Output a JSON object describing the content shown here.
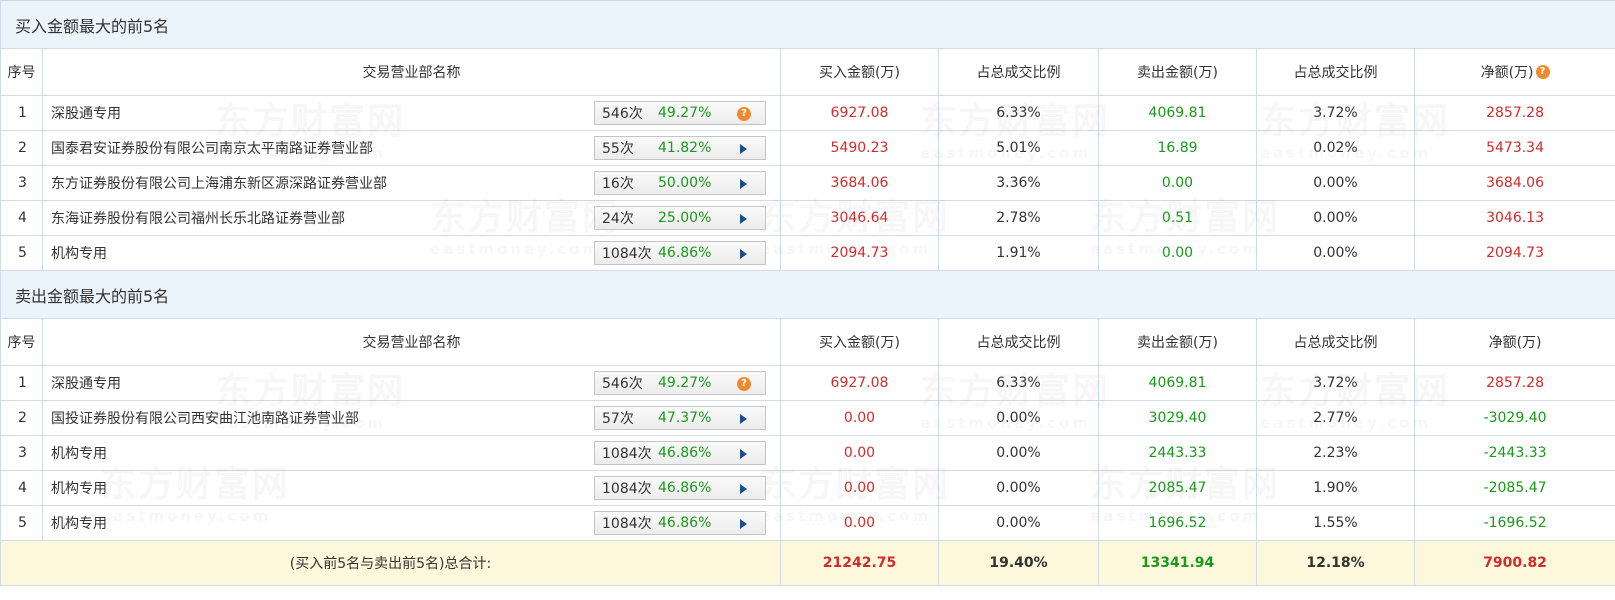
{
  "watermark": {
    "cn": "东方财富网",
    "en": "eastmoney.com"
  },
  "columns": [
    "序号",
    "交易营业部名称",
    "买入金额(万)",
    "占总成交比例",
    "卖出金额(万)",
    "占总成交比例",
    "净额(万)"
  ],
  "buy_section": {
    "title": "买入金额最大的前5名",
    "rows": [
      {
        "idx": "1",
        "name": "深股通专用",
        "count": "546次",
        "pct": "49.27%",
        "icon": "question-icon",
        "buy": "6927.08",
        "buy_ratio": "6.33%",
        "sell": "4069.81",
        "sell_ratio": "3.72%",
        "net": "2857.28"
      },
      {
        "idx": "2",
        "name": "国泰君安证券股份有限公司南京太平南路证券营业部",
        "count": "55次",
        "pct": "41.82%",
        "icon": "play-arrow-icon",
        "buy": "5490.23",
        "buy_ratio": "5.01%",
        "sell": "16.89",
        "sell_ratio": "0.02%",
        "net": "5473.34"
      },
      {
        "idx": "3",
        "name": "东方证券股份有限公司上海浦东新区源深路证券营业部",
        "count": "16次",
        "pct": "50.00%",
        "icon": "play-arrow-icon",
        "buy": "3684.06",
        "buy_ratio": "3.36%",
        "sell": "0.00",
        "sell_ratio": "0.00%",
        "net": "3684.06"
      },
      {
        "idx": "4",
        "name": "东海证券股份有限公司福州长乐北路证券营业部",
        "count": "24次",
        "pct": "25.00%",
        "icon": "play-arrow-icon",
        "buy": "3046.64",
        "buy_ratio": "2.78%",
        "sell": "0.51",
        "sell_ratio": "0.00%",
        "net": "3046.13"
      },
      {
        "idx": "5",
        "name": "机构专用",
        "count": "1084次",
        "pct": "46.86%",
        "icon": "play-arrow-icon",
        "buy": "2094.73",
        "buy_ratio": "1.91%",
        "sell": "0.00",
        "sell_ratio": "0.00%",
        "net": "2094.73"
      }
    ]
  },
  "sell_section": {
    "title": "卖出金额最大的前5名",
    "rows": [
      {
        "idx": "1",
        "name": "深股通专用",
        "count": "546次",
        "pct": "49.27%",
        "icon": "question-icon",
        "buy": "6927.08",
        "buy_ratio": "6.33%",
        "sell": "4069.81",
        "sell_ratio": "3.72%",
        "net": "2857.28"
      },
      {
        "idx": "2",
        "name": "国投证券股份有限公司西安曲江池南路证券营业部",
        "count": "57次",
        "pct": "47.37%",
        "icon": "play-arrow-icon",
        "buy": "0.00",
        "buy_ratio": "0.00%",
        "sell": "3029.40",
        "sell_ratio": "2.77%",
        "net": "-3029.40"
      },
      {
        "idx": "3",
        "name": "机构专用",
        "count": "1084次",
        "pct": "46.86%",
        "icon": "play-arrow-icon",
        "buy": "0.00",
        "buy_ratio": "0.00%",
        "sell": "2443.33",
        "sell_ratio": "2.23%",
        "net": "-2443.33"
      },
      {
        "idx": "4",
        "name": "机构专用",
        "count": "1084次",
        "pct": "46.86%",
        "icon": "play-arrow-icon",
        "buy": "0.00",
        "buy_ratio": "0.00%",
        "sell": "2085.47",
        "sell_ratio": "1.90%",
        "net": "-2085.47"
      },
      {
        "idx": "5",
        "name": "机构专用",
        "count": "1084次",
        "pct": "46.86%",
        "icon": "play-arrow-icon",
        "buy": "0.00",
        "buy_ratio": "0.00%",
        "sell": "1696.52",
        "sell_ratio": "1.55%",
        "net": "-1696.52"
      }
    ]
  },
  "total": {
    "label": "(买入前5名与卖出前5名)总合计:",
    "buy": "21242.75",
    "buy_ratio": "19.40%",
    "sell": "13341.94",
    "sell_ratio": "12.18%",
    "net": "7900.82"
  },
  "colors": {
    "buy": "#d12c2c",
    "sell": "#1a9a1a",
    "header_bg": "#ebf4fb",
    "total_bg": "#fdf7dc"
  }
}
